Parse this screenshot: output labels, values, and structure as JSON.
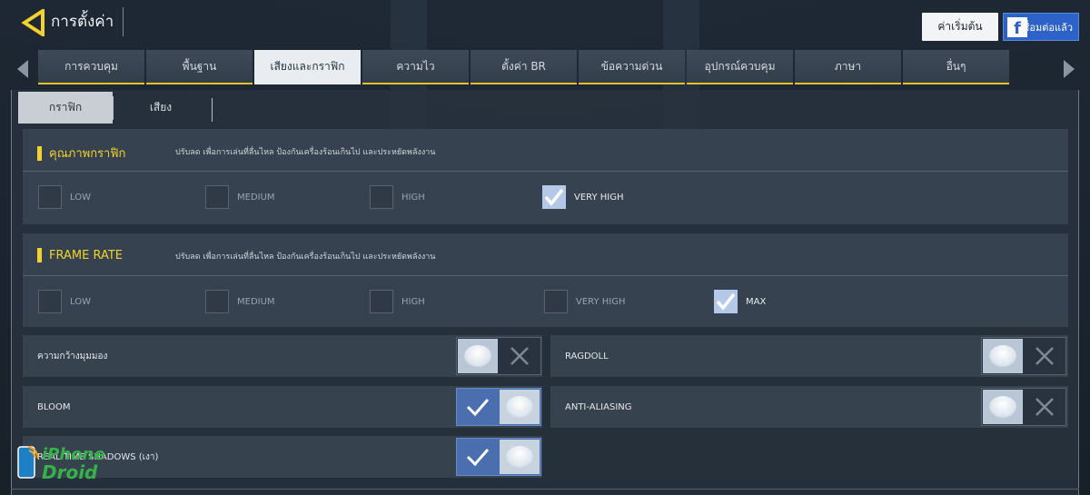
{
  "header": {
    "title": "การตั้งค่า",
    "reset_label": "ค่าเริ่มต้น",
    "facebook_label": "เชื่อมต่อแล้ว"
  },
  "tabs": [
    {
      "label": "การควบคุม",
      "active": false
    },
    {
      "label": "พื้นฐาน",
      "active": false
    },
    {
      "label": "เสียงและกราฟิก",
      "active": true
    },
    {
      "label": "ความไว",
      "active": false
    },
    {
      "label": "ตั้งค่า BR",
      "active": false
    },
    {
      "label": "ข้อความด่วน",
      "active": false
    },
    {
      "label": "อุปกรณ์ควบคุม",
      "active": false
    },
    {
      "label": "ภาษา",
      "active": false
    },
    {
      "label": "อื่นๆ",
      "active": false
    }
  ],
  "subtabs": [
    {
      "label": "กราฟิก",
      "active": true
    },
    {
      "label": "เสียง",
      "active": false
    }
  ],
  "graphics_quality": {
    "title": "คุณภาพกราฟิก",
    "description": "ปรับลด เพื่อการเล่นที่ลื่นไหล ป้องกันเครื่องร้อนเกินไป และประหยัดพลังงาน",
    "options": [
      "LOW",
      "MEDIUM",
      "HIGH",
      "VERY HIGH"
    ],
    "selected": "VERY HIGH"
  },
  "frame_rate": {
    "title": "FRAME RATE",
    "description": "ปรับลด เพื่อการเล่นที่ลื่นไหล ป้องกันเครื่องร้อนเกินไป และประหยัดพลังงาน",
    "options": [
      "LOW",
      "MEDIUM",
      "HIGH",
      "VERY HIGH",
      "MAX"
    ],
    "selected": "MAX"
  },
  "toggles": {
    "fov": {
      "label": "ความกว้างมุมมอง",
      "on": false
    },
    "ragdoll": {
      "label": "RAGDOLL",
      "on": false
    },
    "bloom": {
      "label": "BLOOM",
      "on": true
    },
    "anti_aliasing": {
      "label": "ANTI-ALIASING",
      "on": false
    },
    "shadows": {
      "label": "REAL TIME SHADOWS (เงา)",
      "on": true
    }
  },
  "watermark": {
    "line1": "iPhone",
    "line2": "Droid"
  },
  "colors": {
    "accent": "#f2d22c",
    "toggle_on": "#4b6fae",
    "facebook": "#2d63c8"
  }
}
